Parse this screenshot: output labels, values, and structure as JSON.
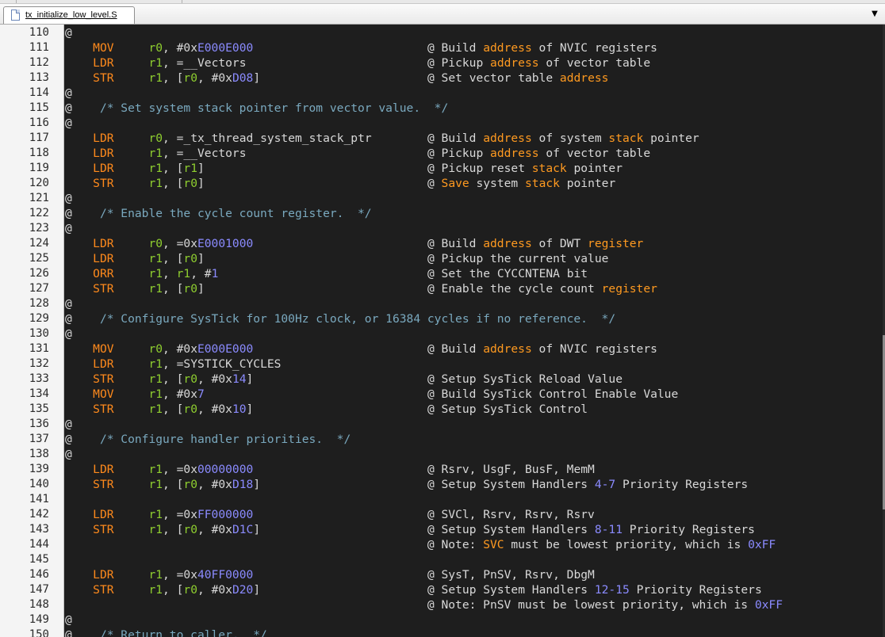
{
  "window": {
    "top_segments": 2
  },
  "tab": {
    "label": "tx_initialize_low_level.S"
  },
  "icons": {
    "file": "file-icon",
    "dropdown": "chevron-down-icon"
  },
  "dropdown_glyph": "▼",
  "colors": {
    "editor_bg": "#1e1e1e",
    "mnemonic": "#ff8a1c",
    "register": "#8fcf2f",
    "number": "#8b8bff",
    "block_comment": "#7aa9bf",
    "comment_keyword": "#ff9a20"
  },
  "lines": [
    {
      "n": "110",
      "t": "@"
    },
    {
      "n": "111",
      "t": "    MOV     r0, #0xE000E000                         @ Build address of NVIC registers"
    },
    {
      "n": "112",
      "t": "    LDR     r1, =__Vectors                          @ Pickup address of vector table"
    },
    {
      "n": "113",
      "t": "    STR     r1, [r0, #0xD08]                        @ Set vector table address"
    },
    {
      "n": "114",
      "t": "@"
    },
    {
      "n": "115",
      "t": "@    /* Set system stack pointer from vector value.  */"
    },
    {
      "n": "116",
      "t": "@"
    },
    {
      "n": "117",
      "t": "    LDR     r0, =_tx_thread_system_stack_ptr        @ Build address of system stack pointer"
    },
    {
      "n": "118",
      "t": "    LDR     r1, =__Vectors                          @ Pickup address of vector table"
    },
    {
      "n": "119",
      "t": "    LDR     r1, [r1]                                @ Pickup reset stack pointer"
    },
    {
      "n": "120",
      "t": "    STR     r1, [r0]                                @ Save system stack pointer"
    },
    {
      "n": "121",
      "t": "@"
    },
    {
      "n": "122",
      "t": "@    /* Enable the cycle count register.  */"
    },
    {
      "n": "123",
      "t": "@"
    },
    {
      "n": "124",
      "t": "    LDR     r0, =0xE0001000                         @ Build address of DWT register"
    },
    {
      "n": "125",
      "t": "    LDR     r1, [r0]                                @ Pickup the current value"
    },
    {
      "n": "126",
      "t": "    ORR     r1, r1, #1                              @ Set the CYCCNTENA bit"
    },
    {
      "n": "127",
      "t": "    STR     r1, [r0]                                @ Enable the cycle count register"
    },
    {
      "n": "128",
      "t": "@"
    },
    {
      "n": "129",
      "t": "@    /* Configure SysTick for 100Hz clock, or 16384 cycles if no reference.  */"
    },
    {
      "n": "130",
      "t": "@"
    },
    {
      "n": "131",
      "t": "    MOV     r0, #0xE000E000                         @ Build address of NVIC registers"
    },
    {
      "n": "132",
      "t": "    LDR     r1, =SYSTICK_CYCLES"
    },
    {
      "n": "133",
      "t": "    STR     r1, [r0, #0x14]                         @ Setup SysTick Reload Value"
    },
    {
      "n": "134",
      "t": "    MOV     r1, #0x7                                @ Build SysTick Control Enable Value"
    },
    {
      "n": "135",
      "t": "    STR     r1, [r0, #0x10]                         @ Setup SysTick Control"
    },
    {
      "n": "136",
      "t": "@"
    },
    {
      "n": "137",
      "t": "@    /* Configure handler priorities.  */"
    },
    {
      "n": "138",
      "t": "@"
    },
    {
      "n": "139",
      "t": "    LDR     r1, =0x00000000                         @ Rsrv, UsgF, BusF, MemM"
    },
    {
      "n": "140",
      "t": "    STR     r1, [r0, #0xD18]                        @ Setup System Handlers 4-7 Priority Registers"
    },
    {
      "n": "141",
      "t": ""
    },
    {
      "n": "142",
      "t": "    LDR     r1, =0xFF000000                         @ SVCl, Rsrv, Rsrv, Rsrv"
    },
    {
      "n": "143",
      "t": "    STR     r1, [r0, #0xD1C]                        @ Setup System Handlers 8-11 Priority Registers"
    },
    {
      "n": "144",
      "t": "                                                    @ Note: SVC must be lowest priority, which is 0xFF"
    },
    {
      "n": "145",
      "t": ""
    },
    {
      "n": "146",
      "t": "    LDR     r1, =0x40FF0000                         @ SysT, PnSV, Rsrv, DbgM"
    },
    {
      "n": "147",
      "t": "    STR     r1, [r0, #0xD20]                        @ Setup System Handlers 12-15 Priority Registers"
    },
    {
      "n": "148",
      "t": "                                                    @ Note: PnSV must be lowest priority, which is 0xFF"
    },
    {
      "n": "149",
      "t": "@"
    },
    {
      "n": "150",
      "t": "@    /* Return to caller.  */"
    }
  ]
}
